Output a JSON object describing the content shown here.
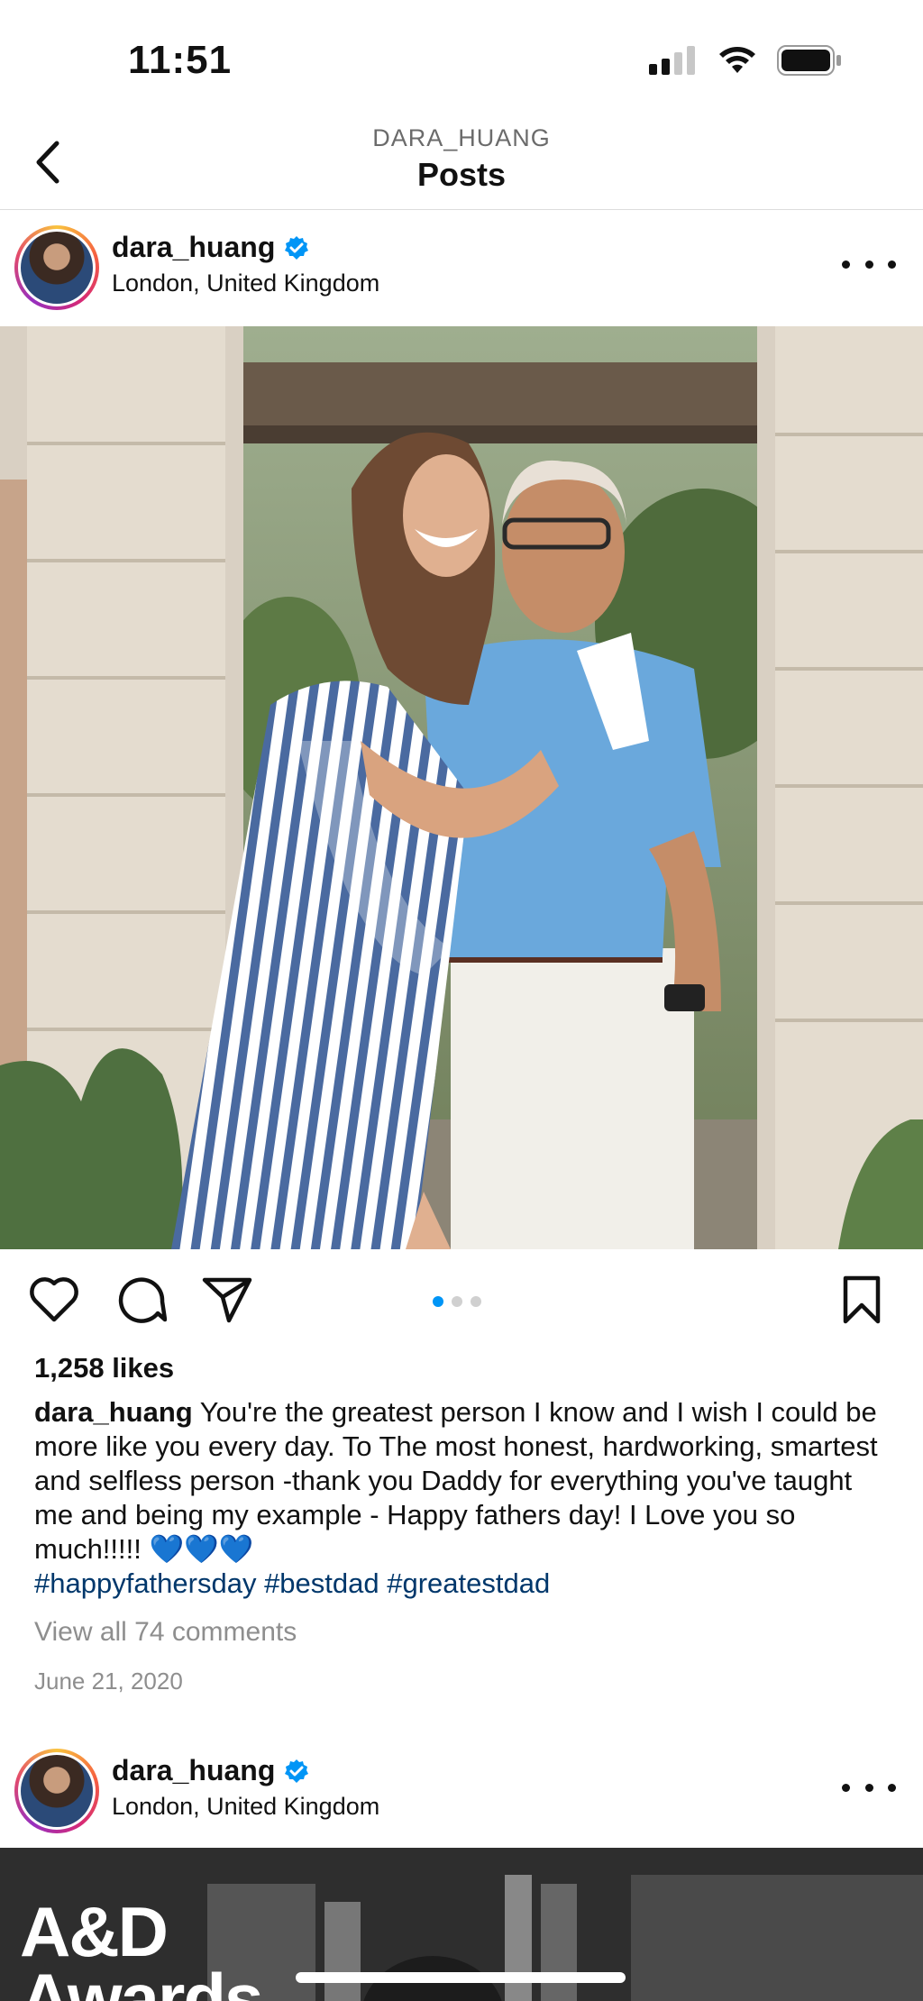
{
  "status_bar": {
    "time": "11:51",
    "signal_icon": "cellular-signal-icon",
    "wifi_icon": "wifi-icon",
    "battery_icon": "battery-icon"
  },
  "header": {
    "subtitle": "DARA_HUANG",
    "title": "Posts",
    "back_icon": "chevron-left-icon"
  },
  "posts": [
    {
      "username": "dara_huang",
      "verified": true,
      "location": "London, United Kingdom",
      "likes": "1,258 likes",
      "caption_user": "dara_huang",
      "caption_text": "You're the greatest person I know and I wish I could be more like you every day.  To The most honest, hardworking, smartest and selfless person -thank you Daddy for everything you've taught me and being my example - Happy fathers day! I Love you so much!!!!! 💙💙💙",
      "hashtags": "#happyfathersday #bestdad #greatestdad",
      "view_comments": "View all 74 comments",
      "date": "June 21, 2020",
      "carousel": {
        "count": 3,
        "active": 0
      }
    },
    {
      "username": "dara_huang",
      "verified": true,
      "location": "London, United Kingdom",
      "image_text_line1": "A&D",
      "image_text_line2": "Awards"
    }
  ],
  "colors": {
    "accent": "#0095f6",
    "hashtag": "#00376b",
    "muted": "#8e8e8e"
  }
}
